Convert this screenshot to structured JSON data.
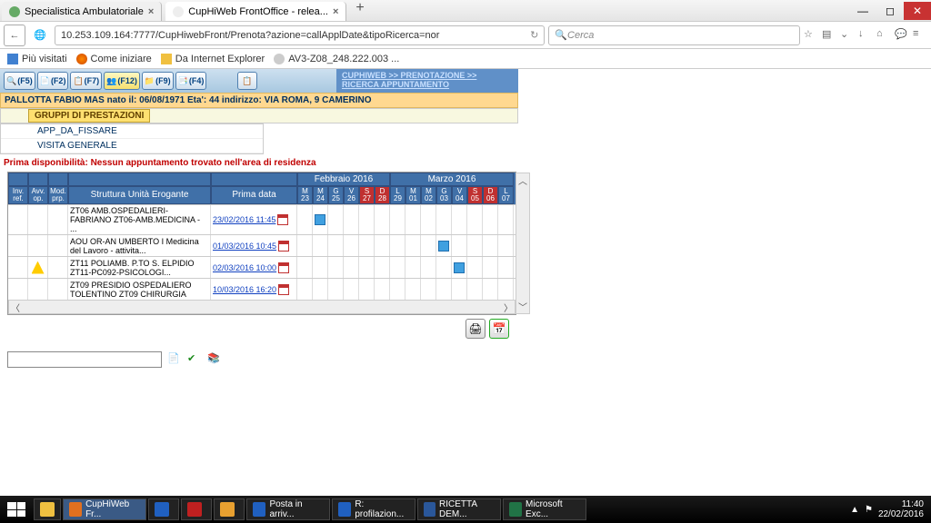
{
  "window": {
    "tabs": [
      {
        "title": "Specialistica Ambulatoriale"
      },
      {
        "title": "CupHiWeb FrontOffice - relea..."
      }
    ],
    "min": "—",
    "max": "◻",
    "close": "✕"
  },
  "nav": {
    "url": "10.253.109.164:7777/CupHiwebFront/Prenota?azione=callApplDate&tipoRicerca=nor",
    "search_placeholder": "Cerca"
  },
  "bookmarks": {
    "b1": "Più visitati",
    "b2": "Come iniziare",
    "b3": "Da Internet Explorer",
    "b4": "AV3-Z08_248.222.003 ..."
  },
  "func": {
    "f5": "(F5)",
    "f2": "(F2)",
    "f7": "(F7)",
    "f12": "(F12)",
    "f9": "(F9)",
    "f4": "(F4)"
  },
  "breadcrumb": {
    "l1": "CUPHIWEB >> PRENOTAZIONE >>",
    "l2": "RICERCA APPUNTAMENTO"
  },
  "patient": "PALLOTTA FABIO   MAS   nato il: 06/08/1971   Eta': 44   indirizzo: VIA ROMA, 9 CAMERINO",
  "group_tab": "GRUPPI DI PRESTAZIONI",
  "sub_items": [
    "APP_DA_FISSARE",
    "VISITA GENERALE"
  ],
  "warning": "Prima disponibilità: Nessun appuntamento trovato nell'area di residenza",
  "months": {
    "m1": "Febbraio 2016",
    "m2": "Marzo 2016"
  },
  "headers": {
    "inv": "Inv. ref.",
    "avv": "Avv. op.",
    "mod": "Mod. prp.",
    "str": "Struttura Unità Erogante",
    "pd": "Prima data"
  },
  "days": [
    {
      "d": "M",
      "n": "23"
    },
    {
      "d": "M",
      "n": "24"
    },
    {
      "d": "G",
      "n": "25"
    },
    {
      "d": "V",
      "n": "26"
    },
    {
      "d": "S",
      "n": "27",
      "r": 1
    },
    {
      "d": "D",
      "n": "28",
      "r": 1
    },
    {
      "d": "L",
      "n": "29"
    },
    {
      "d": "M",
      "n": "01"
    },
    {
      "d": "M",
      "n": "02"
    },
    {
      "d": "G",
      "n": "03"
    },
    {
      "d": "V",
      "n": "04"
    },
    {
      "d": "S",
      "n": "05",
      "r": 1
    },
    {
      "d": "D",
      "n": "06",
      "r": 1
    },
    {
      "d": "L",
      "n": "07"
    }
  ],
  "rows": [
    {
      "str": "ZT06 AMB.OSPEDALIERI-FABRIANO ZT06-AMB.MEDICINA - ...",
      "pd": "23/02/2016 11:45",
      "mark": 1
    },
    {
      "str": "AOU OR-AN UMBERTO I Medicina del Lavoro - attivita...",
      "pd": "01/03/2016 10:45",
      "mark": 9
    },
    {
      "str": "ZT11 POLIAMB. P.TO S. ELPIDIO ZT11-PC092-PSICOLOGI...",
      "pd": "02/03/2016 10:00",
      "mark": 10,
      "warn": 1
    },
    {
      "str": "ZT09 PRESIDIO OSPEDALIERO TOLENTINO ZT09 CHIRURGIA",
      "pd": "10/03/2016 16:20"
    }
  ],
  "taskbar": {
    "items": [
      {
        "label": "CupHiWeb Fr...",
        "color": "#e07020",
        "active": true
      },
      {
        "label": "",
        "color": "#2060c0"
      },
      {
        "label": "",
        "color": "#c02020"
      },
      {
        "label": "",
        "color": "#e8a030"
      },
      {
        "label": "Posta in arriv...",
        "color": "#2060c0"
      },
      {
        "label": "R: profilazion...",
        "color": "#2060c0"
      },
      {
        "label": "RICETTA DEM...",
        "color": "#2a579a"
      },
      {
        "label": "Microsoft Exc...",
        "color": "#217346"
      }
    ],
    "time": "11:40",
    "date": "22/02/2016"
  }
}
